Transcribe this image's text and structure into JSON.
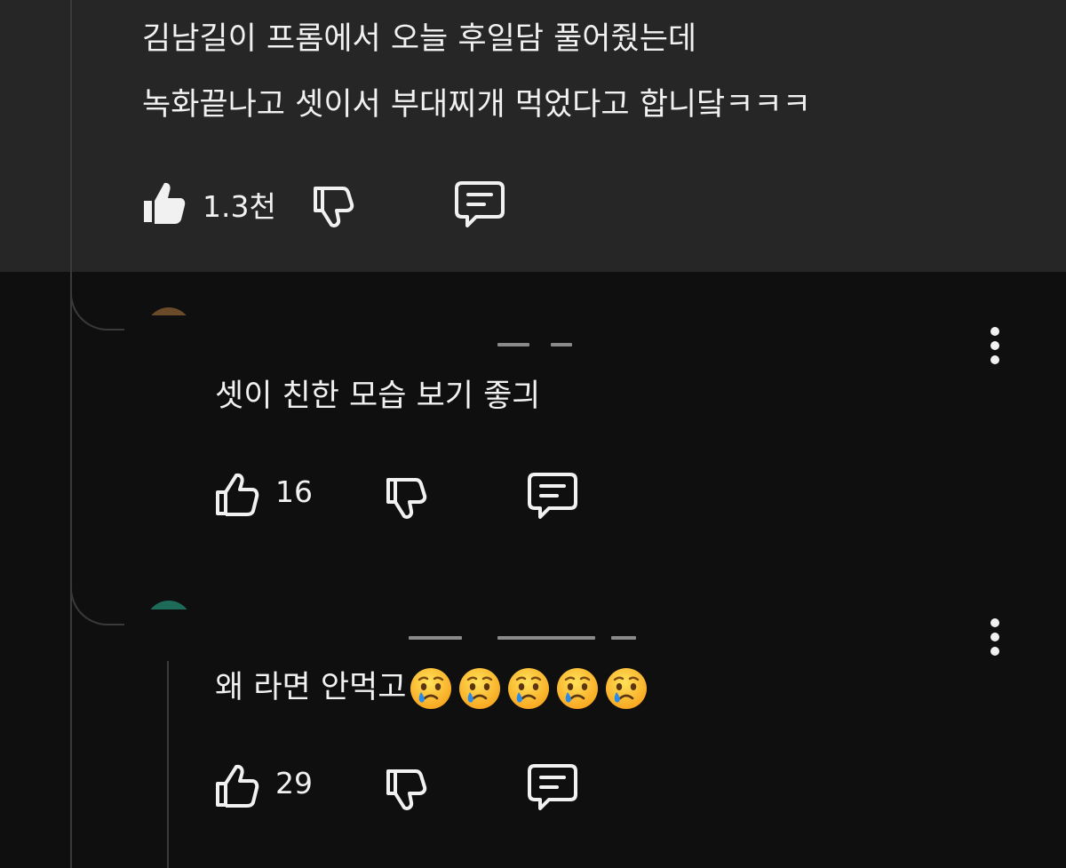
{
  "parent_comment": {
    "lines": [
      "김남길이 프롬에서 오늘 후일담 풀어줬는데",
      "녹화끝나고 셋이서 부대찌개 먹었다고 합니닼ㅋㅋㅋ"
    ],
    "like_count": "1.3천"
  },
  "replies": [
    {
      "text": "셋이 친한 모습 보기 좋긔",
      "emojis": [],
      "like_count": "16"
    },
    {
      "text": "왜 라면 안먹고",
      "emojis": [
        "crying-face",
        "crying-face",
        "crying-face",
        "crying-face",
        "crying-face"
      ],
      "like_count": "29"
    }
  ],
  "colors": {
    "background": "#0f0f0f",
    "highlight_background": "#262626",
    "text": "#f1f1f1",
    "thread_line": "#3a3a3a"
  }
}
